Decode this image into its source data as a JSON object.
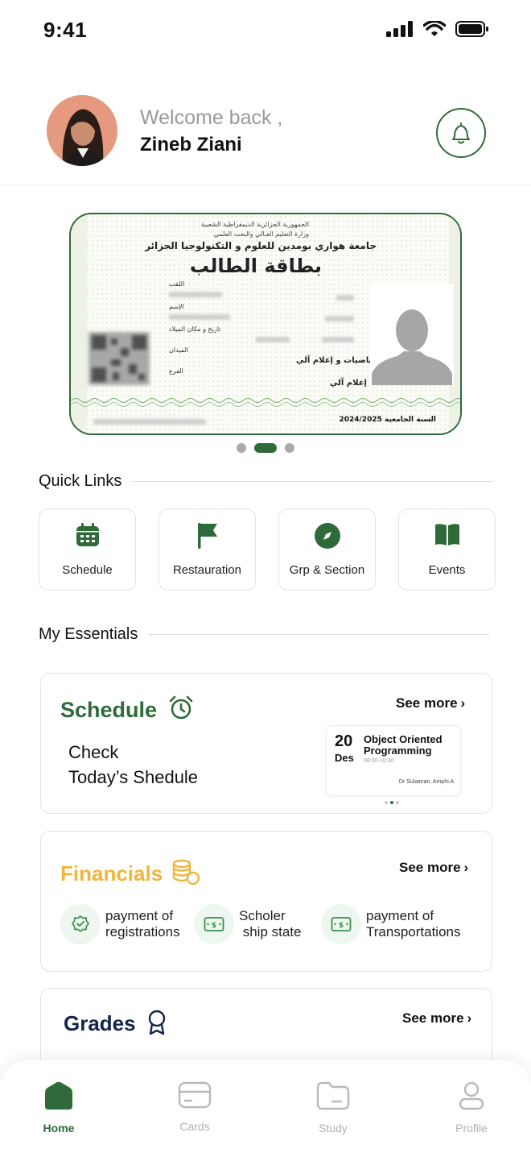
{
  "status_bar": {
    "time": "9:41"
  },
  "header": {
    "welcome": "Welcome back ,",
    "user_name": "Zineb Ziani"
  },
  "student_card": {
    "republic": "الجمهورية الجزائرية الديمقراطية الشعبية",
    "ministry": "وزارة التعليم العـالي والبحث العلمي",
    "university": "جامعة هواري بومدين للعلوم و التكنولوجيا الجزائر",
    "title": "بطاقة الطالب",
    "label_surname": "اللقب",
    "label_name": "الإسم",
    "label_birth": "تاريخ و مكان الميلاد",
    "label_field": "الميدان",
    "label_branch": "الفرع",
    "field_value": "رياضيات و إعلام آلي",
    "branch_value": "إعلام آلي",
    "academic_year": "السنة الجامعية 2024/2025"
  },
  "carousel": {
    "count": 3,
    "active_index": 1
  },
  "quick_links": {
    "title": "Quick Links",
    "items": [
      {
        "label": "Schedule",
        "icon": "calendar-icon"
      },
      {
        "label": "Restauration",
        "icon": "flag-icon"
      },
      {
        "label": "Grp & Section",
        "icon": "compass-icon"
      },
      {
        "label": "Events",
        "icon": "book-open-icon"
      }
    ]
  },
  "essentials": {
    "title": "My Essentials",
    "schedule": {
      "title": "Schedule",
      "see_more": "See more",
      "subtitle_line1": "Check",
      "subtitle_line2": "Today’s Shedule",
      "event": {
        "day": "20",
        "month": "Des",
        "title": "Object Oriented Programming",
        "time": "08:00-10:30",
        "location": "Dr Sulaiman, Amphi A"
      }
    },
    "financials": {
      "title": "Financials",
      "see_more": "See more",
      "items": [
        {
          "line1": "payment of",
          "line2": "registrations",
          "icon": "badge-check-icon"
        },
        {
          "line1": "Scholer",
          "line2": " ship state",
          "icon": "money-icon"
        },
        {
          "line1": "payment of",
          "line2": "Transportations",
          "icon": "money-icon"
        }
      ]
    },
    "grades": {
      "title": "Grades",
      "see_more": "See more"
    }
  },
  "bottom_nav": {
    "items": [
      {
        "label": "Home",
        "icon": "home-icon",
        "active": true
      },
      {
        "label": "Cards",
        "icon": "card-icon",
        "active": false
      },
      {
        "label": "Study",
        "icon": "folder-icon",
        "active": false
      },
      {
        "label": "Profile",
        "icon": "user-icon",
        "active": false
      }
    ]
  },
  "colors": {
    "primary_green": "#2f6b3a",
    "financials_yellow": "#f0b63a",
    "grades_navy": "#13254a"
  }
}
